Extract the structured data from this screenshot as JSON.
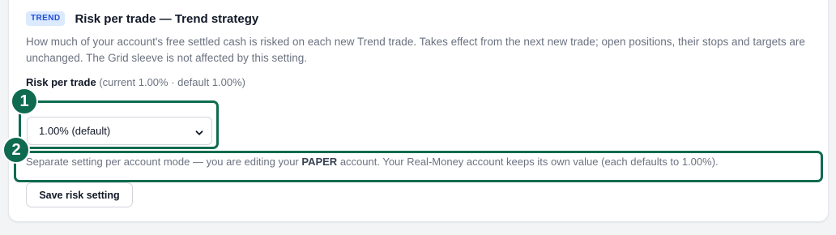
{
  "header": {
    "badge": "TREND",
    "title": "Risk per trade — Trend strategy"
  },
  "description": "How much of your account's free settled cash is risked on each new Trend trade. Takes effect from the next new trade; open positions, their stops and targets are unchanged. The Grid sleeve is not affected by this setting.",
  "field": {
    "label": "Risk per trade",
    "meta": "(current 1.00% · default 1.00%)",
    "select_value": "1.00% (default)"
  },
  "note": {
    "before": "Separate setting per account mode — you are editing your ",
    "mode": "PAPER",
    "after": " account. Your Real-Money account keeps its own value (each defaults to 1.00%)."
  },
  "save_label": "Save risk setting",
  "annotations": {
    "marker1": "1",
    "marker2": "2"
  },
  "colors": {
    "accent": "#0f6b4f",
    "badge_bg": "#dbeafe",
    "badge_text": "#1d4ed8"
  }
}
